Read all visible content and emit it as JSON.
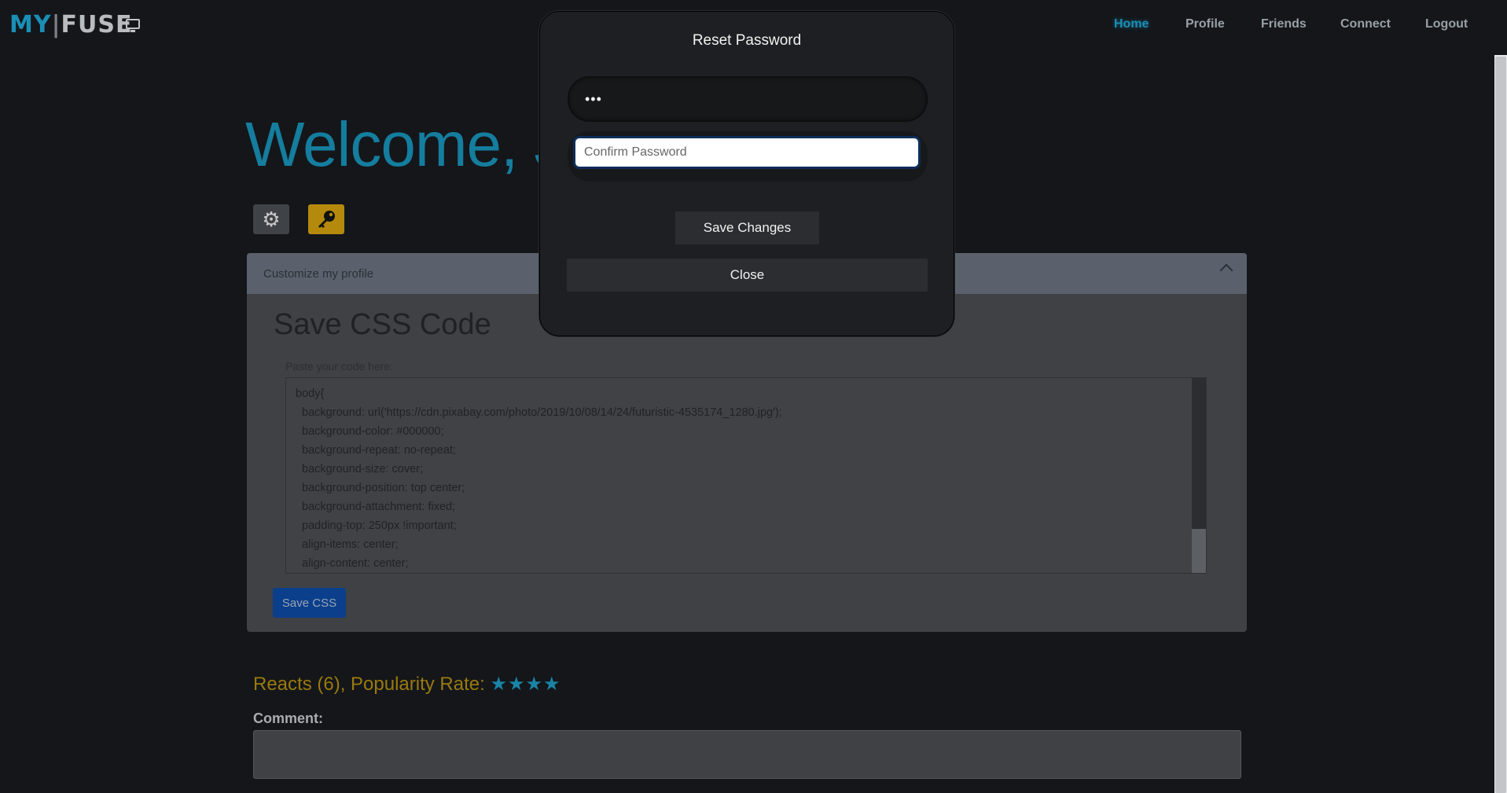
{
  "brand": {
    "my": "MY",
    "bar": "|",
    "fuse": "FUSE"
  },
  "nav": [
    "Home",
    "Profile",
    "Friends",
    "Connect",
    "Logout"
  ],
  "welcome": "Welcome, J",
  "card": {
    "header": "Customize my profile",
    "title": "Save CSS Code",
    "paste_label": "Paste your code here:",
    "code": "body{\n  background: url('https://cdn.pixabay.com/photo/2019/10/08/14/24/futuristic-4535174_1280.jpg');\n  background-color: #000000;\n  background-repeat: no-repeat;\n  background-size: cover;\n  background-position: top center;\n  background-attachment: fixed;\n  padding-top: 250px !important;\n  align-items: center;\n  align-content: center;",
    "save_button": "Save CSS"
  },
  "reacts": {
    "text": "Reacts (6),  Popularity Rate: ",
    "stars": "★★★★"
  },
  "comment_label": "Comment:",
  "modal": {
    "title": "Reset Password",
    "password_value": "•••",
    "confirm_placeholder": "Confirm Password",
    "save_changes": "Save Changes",
    "close": "Close"
  }
}
